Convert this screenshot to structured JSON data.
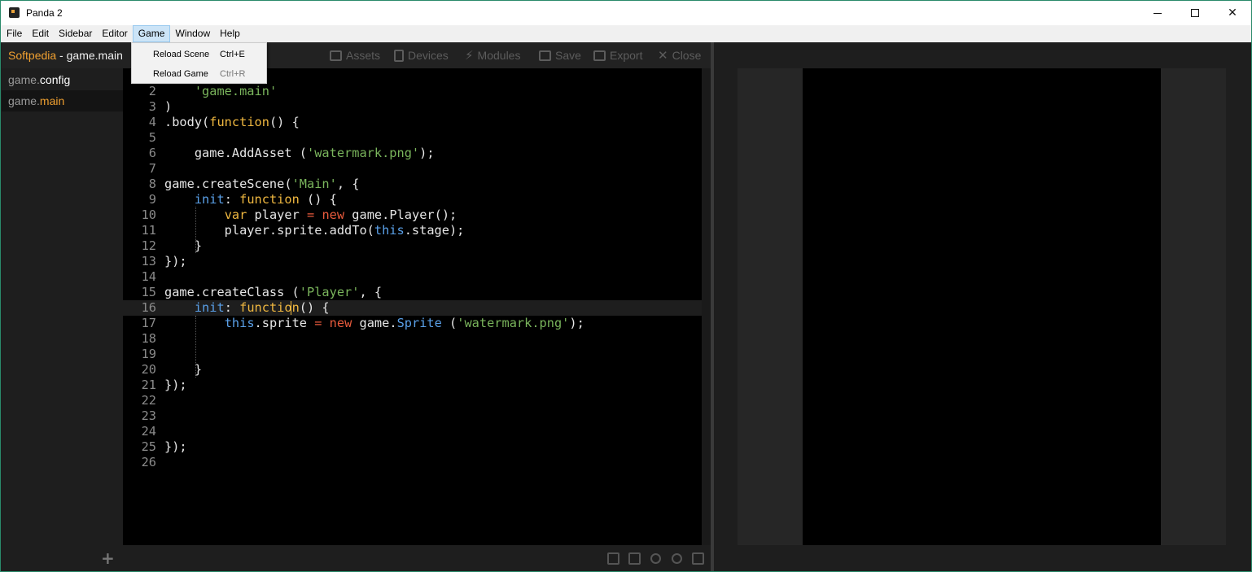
{
  "window": {
    "title": "Panda 2",
    "controls": [
      "minimize",
      "maximize",
      "close"
    ]
  },
  "menubar": {
    "items": [
      "File",
      "Edit",
      "Sidebar",
      "Editor",
      "Game",
      "Window",
      "Help"
    ],
    "active": "Game"
  },
  "game_menu": {
    "items": [
      {
        "label": "Reload Scene",
        "shortcut": "Ctrl+E"
      },
      {
        "label": "Reload Game",
        "shortcut": "Ctrl+R"
      }
    ]
  },
  "sidebar": {
    "header": {
      "brand": "Softpedia",
      "separator": " - ",
      "file": "game.main"
    },
    "files": [
      {
        "base": "game.",
        "ext": "config"
      },
      {
        "base": "game.",
        "ext": "main"
      }
    ],
    "selected": "game.main",
    "add_glyph": "+"
  },
  "toolbar": {
    "buttons": [
      "Assets",
      "Devices",
      "Modules",
      "Save",
      "Export",
      "Close"
    ]
  },
  "editor": {
    "current_line": 16,
    "line_numbers": [
      "2",
      "3",
      "4",
      "5",
      "6",
      "7",
      "8",
      "9",
      "10",
      "11",
      "12",
      "13",
      "14",
      "15",
      "16",
      "17",
      "18",
      "19",
      "20",
      "21",
      "22",
      "23",
      "24",
      "25",
      "26"
    ]
  },
  "colors": {
    "accent": "#f0a030",
    "keyword": "#f0b840",
    "string": "#7ab55c",
    "this_keyword": "#5aa0e8",
    "operator": "#e85a3c",
    "editor_bg": "#000000",
    "panel_bg": "#1e1e1e"
  },
  "icons": {
    "assets": "image-icon",
    "devices": "device-icon",
    "modules": "bolt-icon",
    "save": "save-icon",
    "export": "export-icon",
    "close": "close-icon"
  }
}
